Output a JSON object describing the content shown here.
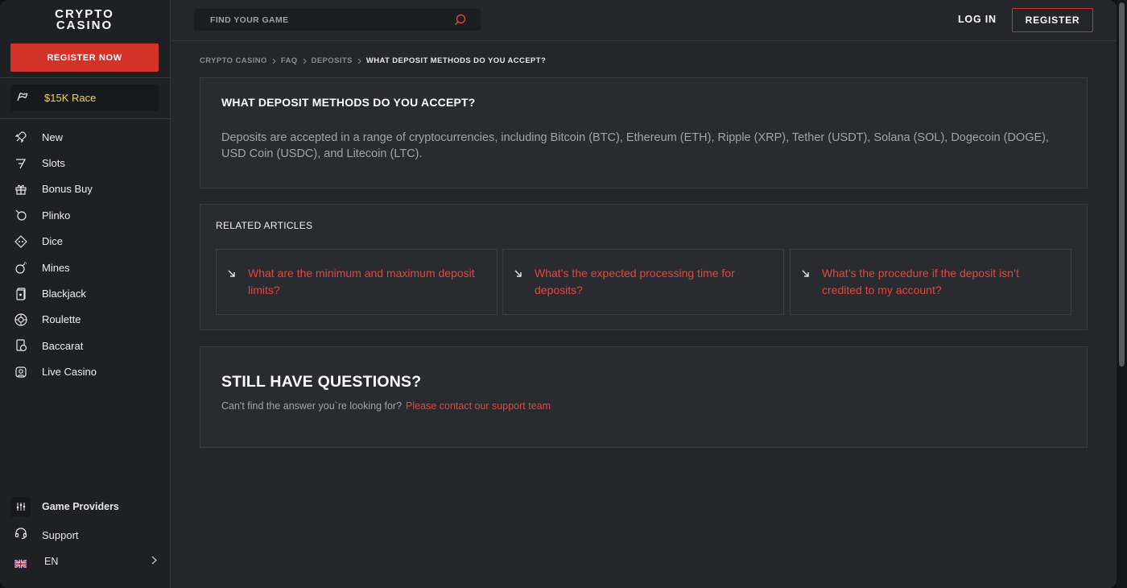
{
  "brand": {
    "logo_line1": "CRYPTO",
    "logo_line2": "CASINO"
  },
  "sidebar": {
    "register_now": "REGISTER NOW",
    "race": {
      "label": "$15K Race",
      "icon": "race-flag-icon",
      "color": "#f2d25a"
    },
    "items": [
      {
        "label": "New",
        "icon": "rocket-icon"
      },
      {
        "label": "Slots",
        "icon": "seven-icon"
      },
      {
        "label": "Bonus Buy",
        "icon": "gift-icon"
      },
      {
        "label": "Plinko",
        "icon": "plinko-icon"
      },
      {
        "label": "Dice",
        "icon": "dice-icon"
      },
      {
        "label": "Mines",
        "icon": "bomb-icon"
      },
      {
        "label": "Blackjack",
        "icon": "cards-icon"
      },
      {
        "label": "Roulette",
        "icon": "roulette-icon"
      },
      {
        "label": "Baccarat",
        "icon": "baccarat-icon"
      },
      {
        "label": "Live Casino",
        "icon": "live-dealer-icon"
      }
    ],
    "providers": "Game Providers",
    "support": "Support",
    "language": "EN"
  },
  "header": {
    "search_placeholder": "FIND YOUR GAME",
    "login": "LOG IN",
    "register": "REGISTER"
  },
  "breadcrumb": [
    "CRYPTO CASINO",
    "FAQ",
    "DEPOSITS",
    "WHAT DEPOSIT METHODS DO YOU ACCEPT?"
  ],
  "article": {
    "title": "WHAT DEPOSIT METHODS DO YOU ACCEPT?",
    "answer": "Deposits are accepted in a range of cryptocurrencies, including Bitcoin (BTC), Ethereum (ETH), Ripple (XRP), Tether (USDT), Solana (SOL), Dogecoin (DOGE), USD Coin (USDC), and Litecoin (LTC)."
  },
  "related": {
    "title": "RELATED ARTICLES",
    "items": [
      "What are the minimum and maximum deposit limits?",
      "What’s the expected processing time for deposits?",
      "What’s the procedure if the deposit isn’t credited to my account?"
    ]
  },
  "questions": {
    "title": "STILL HAVE QUESTIONS?",
    "prompt": "Can't find the answer you`re looking for?",
    "link": "Please contact our support team"
  },
  "colors": {
    "accent": "#d33228",
    "link": "#e0483c",
    "background": "#25262b",
    "sidebar": "#1f2024"
  }
}
